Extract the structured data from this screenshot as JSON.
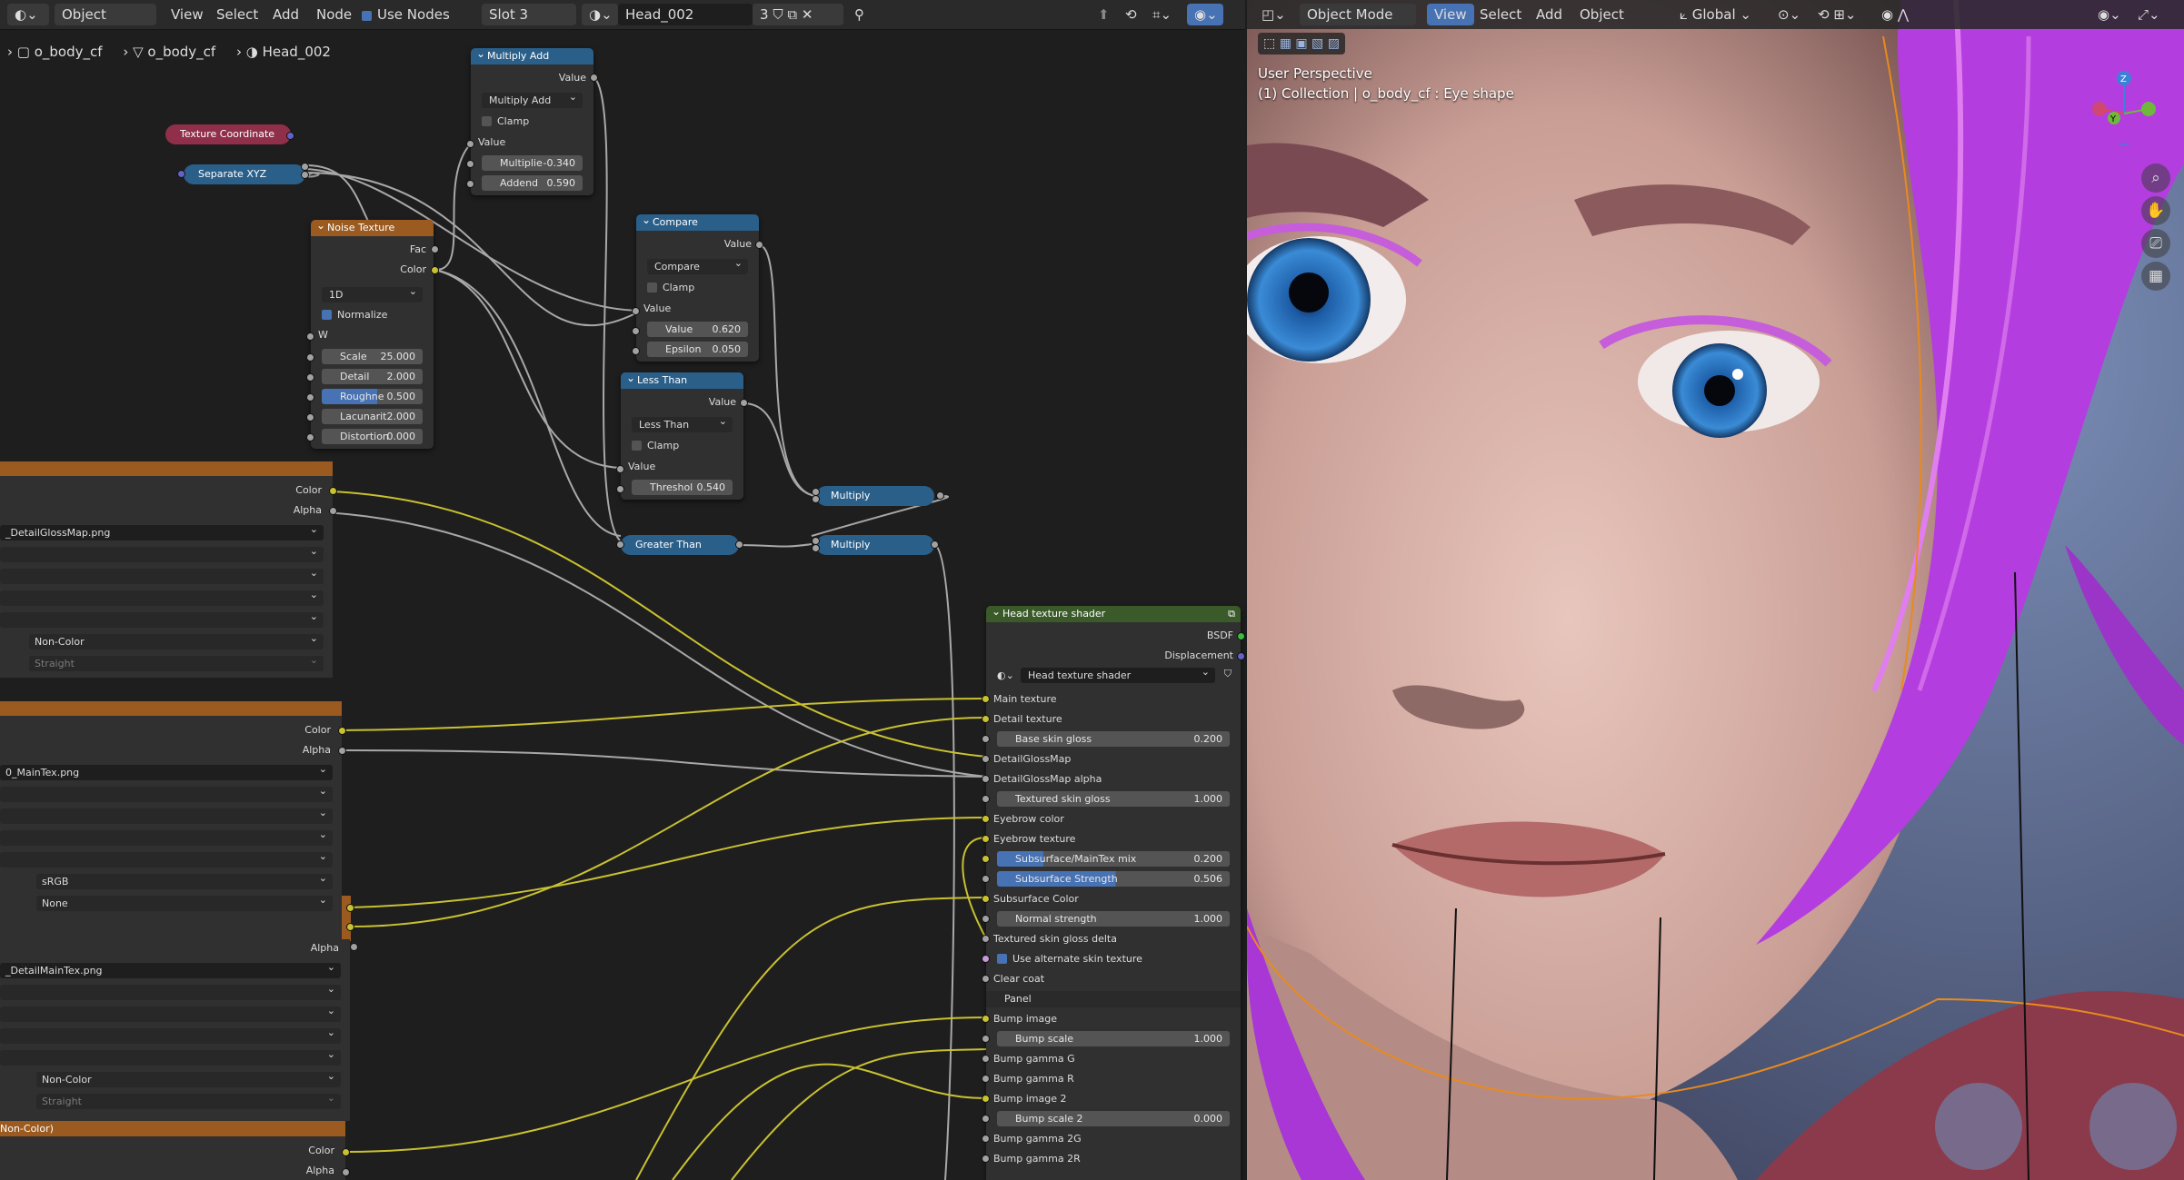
{
  "node_editor": {
    "header": {
      "mode": "Object",
      "menus": [
        "View",
        "Select",
        "Add",
        "Node"
      ],
      "use_nodes_label": "Use Nodes",
      "slot": "Slot 3",
      "material": "Head_002",
      "user_count": "3"
    },
    "breadcrumb": [
      "o_body_cf",
      "o_body_cf",
      "Head_002"
    ],
    "nodes": {
      "texture_coordinate": "Texture Coordinate",
      "separate_xyz": "Separate XYZ",
      "multiply_add": {
        "title": "Multiply Add",
        "out": "Value",
        "op": "Multiply Add",
        "clamp": "Clamp",
        "in": "Value",
        "mult_label": "Multiplie",
        "mult_val": "-0.340",
        "add_label": "Addend",
        "add_val": "0.590"
      },
      "noise": {
        "title": "Noise Texture",
        "fac": "Fac",
        "color": "Color",
        "dim": "1D",
        "normalize": "Normalize",
        "w": "W",
        "scale_l": "Scale",
        "scale_v": "25.000",
        "detail_l": "Detail",
        "detail_v": "2.000",
        "rough_l": "Roughne",
        "rough_v": "0.500",
        "lac_l": "Lacunarit",
        "lac_v": "2.000",
        "dist_l": "Distortion",
        "dist_v": "0.000"
      },
      "compare": {
        "title": "Compare",
        "out": "Value",
        "op": "Compare",
        "clamp": "Clamp",
        "in": "Value",
        "value_l": "Value",
        "value_v": "0.620",
        "eps_l": "Epsilon",
        "eps_v": "0.050"
      },
      "less_than": {
        "title": "Less Than",
        "out": "Value",
        "op": "Less Than",
        "clamp": "Clamp",
        "in": "Value",
        "thr_l": "Threshol",
        "thr_v": "0.540"
      },
      "greater_than": "Greater Than",
      "multiply1": "Multiply",
      "multiply2": "Multiply",
      "tex1": {
        "color": "Color",
        "alpha": "Alpha",
        "file": "_DetailGlossMap.png",
        "colorspace": "Non-Color",
        "alpha_mode": "Straight"
      },
      "tex2": {
        "color": "Color",
        "alpha": "Alpha",
        "file": "0_MainTex.png",
        "colorspace": "sRGB",
        "alpha_mode": "None"
      },
      "tex3": {
        "alpha": "Alpha",
        "file": "_DetailMainTex.png",
        "colorspace": "Non-Color",
        "alpha_mode": "Straight"
      },
      "tex4": {
        "header": "Non-Color)",
        "color": "Color",
        "alpha": "Alpha"
      },
      "group": {
        "title": "Head texture shader",
        "bsdf": "BSDF",
        "displacement": "Displacement",
        "datablock": "Head texture shader",
        "inputs": [
          {
            "label": "Main texture",
            "kind": "socket"
          },
          {
            "label": "Detail texture",
            "kind": "socket"
          },
          {
            "label": "Base skin gloss",
            "kind": "field",
            "value": "0.200",
            "fill": 0.0
          },
          {
            "label": "DetailGlossMap",
            "kind": "socket"
          },
          {
            "label": "DetailGlossMap alpha",
            "kind": "socket"
          },
          {
            "label": "Textured skin gloss",
            "kind": "field",
            "value": "1.000",
            "fill": 0.0
          },
          {
            "label": "Eyebrow color",
            "kind": "socket"
          },
          {
            "label": "Eyebrow texture",
            "kind": "socket"
          },
          {
            "label": "Subsurface/MainTex mix",
            "kind": "field",
            "value": "0.200",
            "fill": 0.2
          },
          {
            "label": "Subsurface Strength",
            "kind": "field",
            "value": "0.506",
            "fill": 0.506
          },
          {
            "label": "Subsurface Color",
            "kind": "socket"
          },
          {
            "label": "Normal strength",
            "kind": "field",
            "value": "1.000",
            "fill": 0.0
          },
          {
            "label": "Textured skin gloss delta",
            "kind": "socket"
          },
          {
            "label": "Use alternate skin texture",
            "kind": "check"
          },
          {
            "label": "Clear coat",
            "kind": "socket"
          },
          {
            "label": "Panel",
            "kind": "panel"
          },
          {
            "label": "Bump image",
            "kind": "socket"
          },
          {
            "label": "Bump scale",
            "kind": "field",
            "value": "1.000",
            "fill": 0.0
          },
          {
            "label": "Bump gamma G",
            "kind": "socket"
          },
          {
            "label": "Bump gamma R",
            "kind": "socket"
          },
          {
            "label": "Bump image 2",
            "kind": "socket"
          },
          {
            "label": "Bump scale 2",
            "kind": "field",
            "value": "0.000",
            "fill": 0.0
          },
          {
            "label": "Bump gamma 2G",
            "kind": "socket"
          },
          {
            "label": "Bump gamma 2R",
            "kind": "socket"
          }
        ]
      }
    }
  },
  "viewport": {
    "header": {
      "mode": "Object Mode",
      "menus": [
        "View",
        "Select",
        "Add",
        "Object"
      ],
      "orientation": "Global"
    },
    "info_line1": "User Perspective",
    "info_line2": "(1) Collection | o_body_cf : Eye shape",
    "gizmo": {
      "z": "Z",
      "y": "Y"
    }
  },
  "colors": {
    "accent": "#4772b3",
    "group_header": "#3b5a2a",
    "texture_header": "#9a5a20",
    "math_header": "#2a5f8a",
    "yellow_wire": "#c9c130",
    "gray_wire": "#9a9a9a",
    "hair": "#b43de0"
  }
}
